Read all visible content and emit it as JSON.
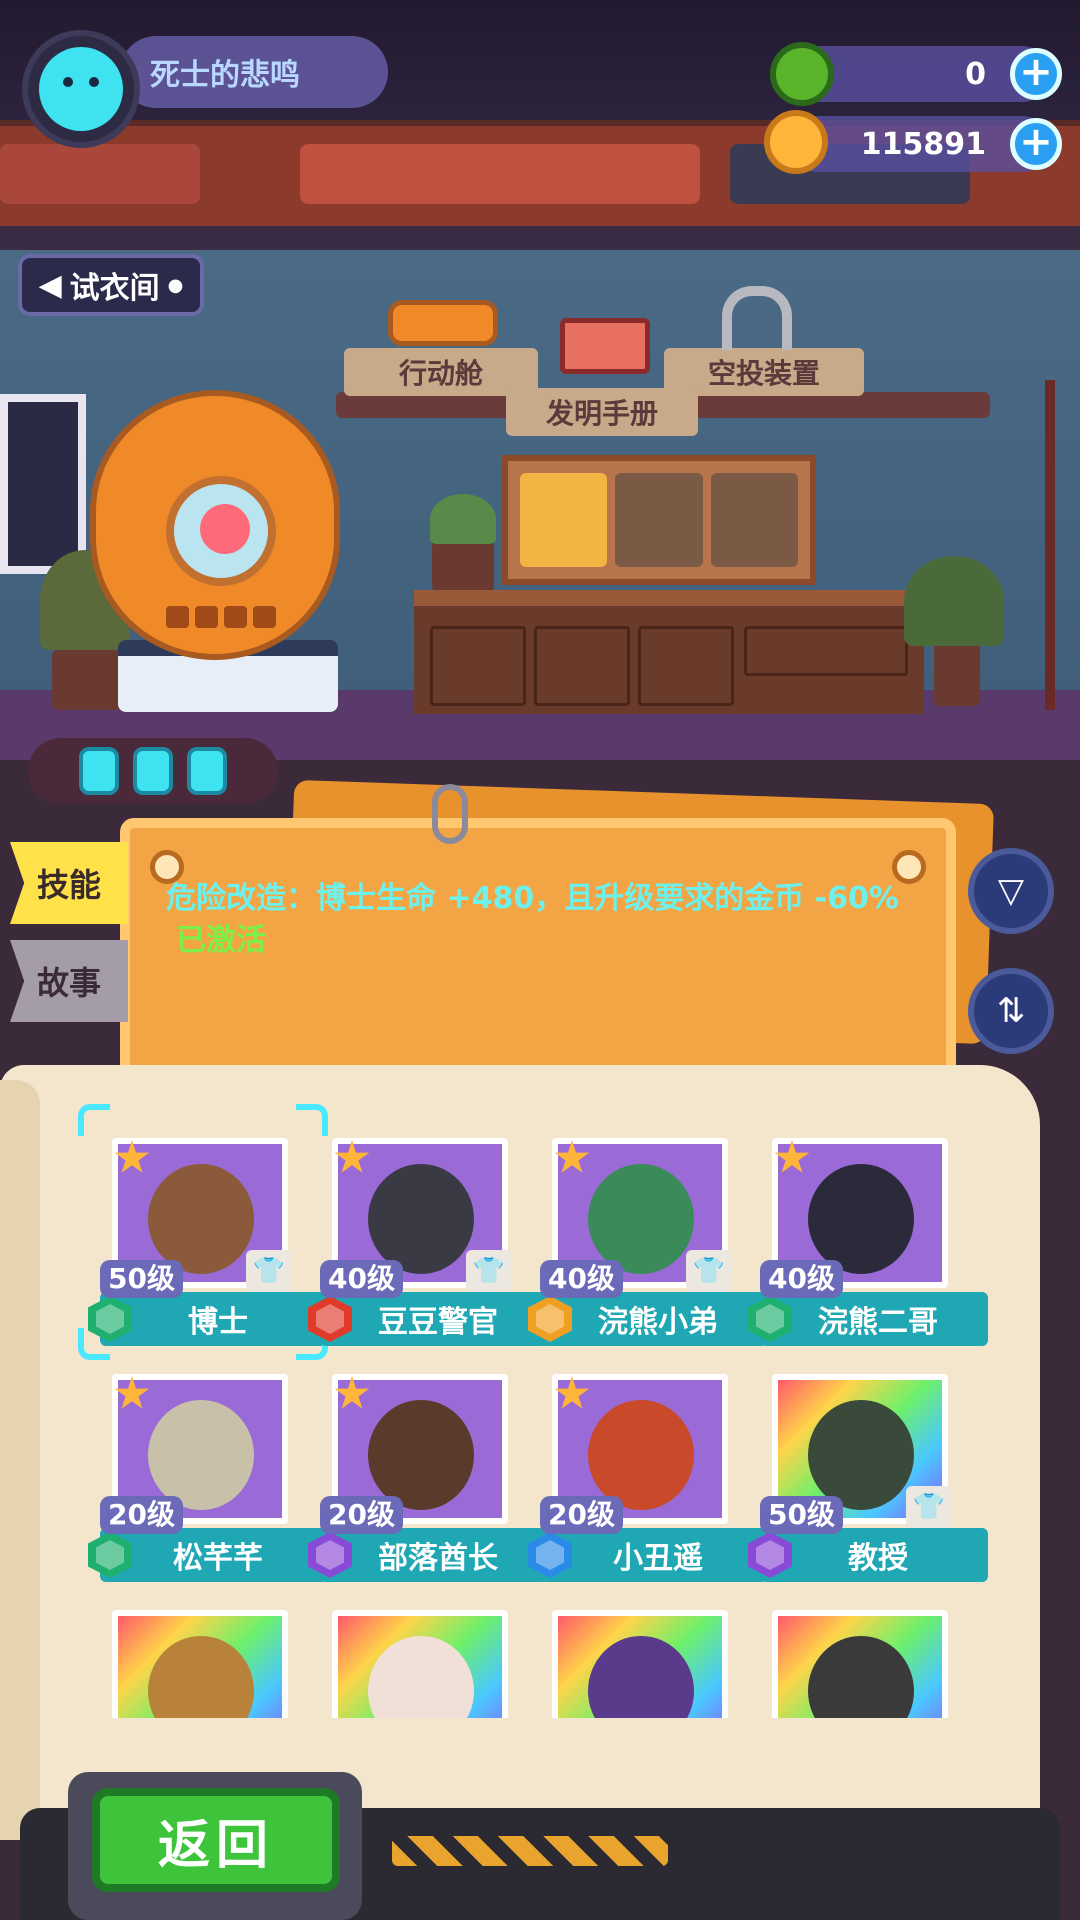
{
  "player": {
    "name": "死士的悲鸣"
  },
  "currencies": [
    {
      "name": "gem",
      "value": "0",
      "color": "#5ab42a"
    },
    {
      "name": "gold-coin",
      "value": "115891",
      "color": "#ffb43a"
    }
  ],
  "fitting_room": {
    "label": "试衣间"
  },
  "room_signs": {
    "action_pod": "行动舱",
    "airdrop_device": "空投装置",
    "invention_manual": "发明手册"
  },
  "side_tabs": {
    "skill": "技能",
    "story": "故事"
  },
  "skill": {
    "description": "危险改造：博士生命 +480，且升级要求的金币 -60% ",
    "status": "已激活"
  },
  "characters": [
    {
      "name": "博士",
      "level": "50级",
      "starred": true,
      "shirt": true,
      "selected": true,
      "badge_color": "#1fb070",
      "portrait": "#9a6ad6",
      "head": "#8a5a3a"
    },
    {
      "name": "豆豆警官",
      "level": "40级",
      "starred": true,
      "shirt": true,
      "selected": false,
      "badge_color": "#e03a2a",
      "portrait": "#9a6ad6",
      "head": "#3a3a44"
    },
    {
      "name": "浣熊小弟",
      "level": "40级",
      "starred": true,
      "shirt": true,
      "selected": false,
      "badge_color": "#f0a020",
      "portrait": "#9a6ad6",
      "head": "#3a8a5a"
    },
    {
      "name": "浣熊二哥",
      "level": "40级",
      "starred": true,
      "shirt": false,
      "selected": false,
      "badge_color": "#1fb070",
      "portrait": "#9a6ad6",
      "head": "#2a2a3a"
    },
    {
      "name": "松芊芊",
      "level": "20级",
      "starred": true,
      "shirt": false,
      "selected": false,
      "badge_color": "#1fb070",
      "portrait": "#9a6ad6",
      "head": "#c8c0a8"
    },
    {
      "name": "部落酋长",
      "level": "20级",
      "starred": true,
      "shirt": false,
      "selected": false,
      "badge_color": "#8a4ad8",
      "portrait": "#9a6ad6",
      "head": "#5a3a2a"
    },
    {
      "name": "小丑遥",
      "level": "20级",
      "starred": true,
      "shirt": false,
      "selected": false,
      "badge_color": "#2a8ae8",
      "portrait": "#9a6ad6",
      "head": "#c84a2a"
    },
    {
      "name": "教授",
      "level": "50级",
      "starred": false,
      "shirt": true,
      "selected": false,
      "badge_color": "#8a4ad8",
      "portrait": "rainbow",
      "head": "#3a4a3a"
    },
    {
      "name": "",
      "level": "",
      "starred": false,
      "shirt": false,
      "selected": false,
      "badge_color": "",
      "portrait": "rainbow",
      "head": "#b8823a"
    },
    {
      "name": "",
      "level": "",
      "starred": false,
      "shirt": false,
      "selected": false,
      "badge_color": "",
      "portrait": "rainbow",
      "head": "#f0e0d8"
    },
    {
      "name": "",
      "level": "",
      "starred": false,
      "shirt": false,
      "selected": false,
      "badge_color": "",
      "portrait": "rainbow",
      "head": "#5a3a8a"
    },
    {
      "name": "",
      "level": "",
      "starred": false,
      "shirt": false,
      "selected": false,
      "badge_color": "",
      "portrait": "rainbow",
      "head": "#3a3a3a"
    }
  ],
  "back_button": {
    "label": "返回"
  },
  "accent_colors": {
    "cyan": "#4ae8ff",
    "teal_bar": "#1fa7b4",
    "panel_orange": "#f3a444"
  }
}
